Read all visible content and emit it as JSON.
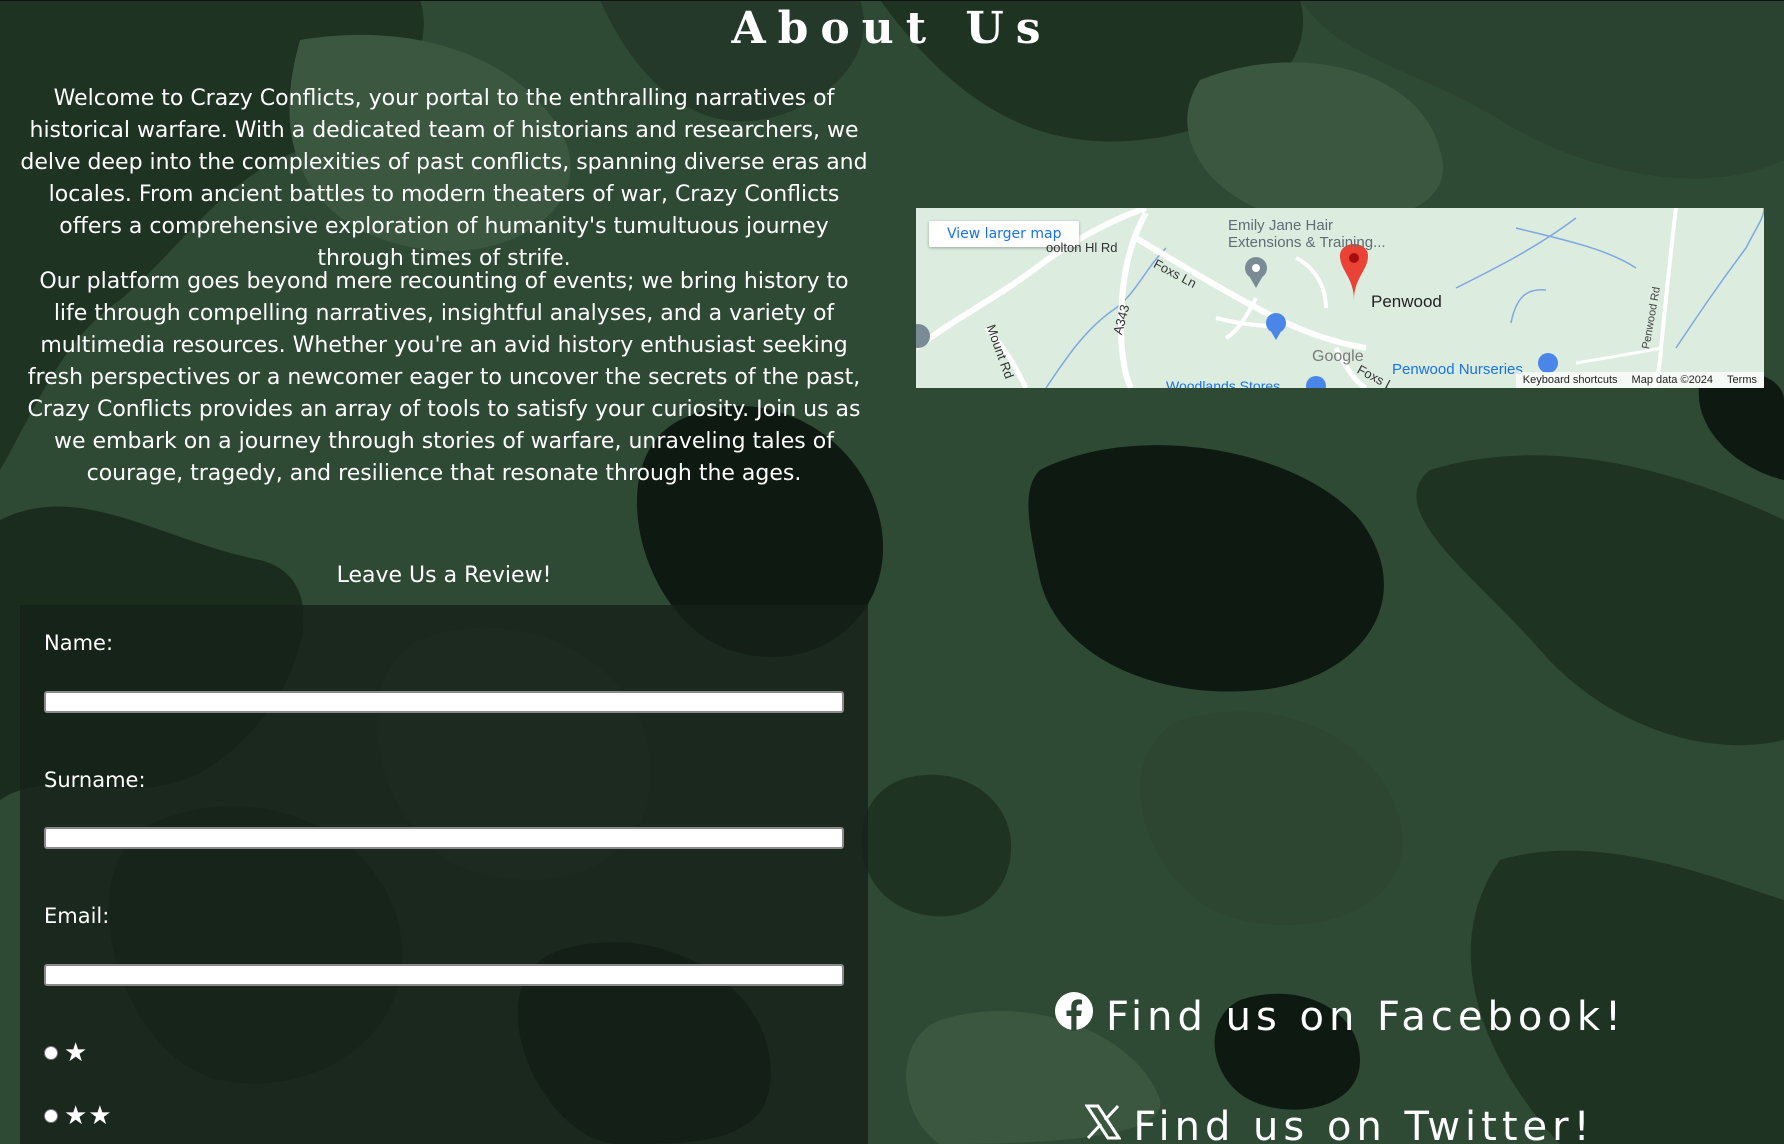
{
  "page": {
    "title": "About Us"
  },
  "about": {
    "paragraph1": "Welcome to Crazy Conflicts, your portal to the enthralling narratives of historical warfare. With a dedicated team of historians and researchers, we delve deep into the complexities of past conflicts, spanning diverse eras and locales. From ancient battles to modern theaters of war, Crazy Conflicts offers a comprehensive exploration of humanity's tumultuous journey through times of strife.",
    "paragraph2": "Our platform goes beyond mere recounting of events; we bring history to life through compelling narratives, insightful analyses, and a variety of multimedia resources. Whether you're an avid history enthusiast seeking fresh perspectives or a newcomer eager to uncover the secrets of the past, Crazy Conflicts provides an array of tools to satisfy your curiosity. Join us as we embark on a journey through stories of warfare, unraveling tales of courage, tragedy, and resilience that resonate through the ages."
  },
  "review": {
    "heading": "Leave Us a Review!",
    "name_label": "Name:",
    "name_value": "",
    "surname_label": "Surname:",
    "surname_value": "",
    "email_label": "Email:",
    "email_value": "",
    "ratings": [
      {
        "stars": "★"
      },
      {
        "stars": "★★"
      }
    ]
  },
  "map": {
    "button": "View larger map",
    "labels": {
      "business": "Emily Jane Hair",
      "business2": "Extensions & Training...",
      "road1": "oolton Hl Rd",
      "road2": "Foxs Ln",
      "road3": "A343",
      "road4": "Mount Rd",
      "road5": "Penwood Rd",
      "road6": "Foxs L",
      "place": "Penwood",
      "nursery": "Penwood Nurseries",
      "store": "Woodlands Stores",
      "google": "Google"
    },
    "footer": {
      "shortcuts": "Keyboard shortcuts",
      "mapdata": "Map data ©2024",
      "terms": "Terms"
    },
    "colors": {
      "land": "#dcecdf",
      "pin": "#ea4335",
      "water": "#7fa7e0",
      "link": "#1a73e8"
    }
  },
  "social": {
    "facebook": "Find us on Facebook!",
    "twitter": "Find us on Twitter!",
    "facebook_icon": "facebook-icon",
    "twitter_icon": "x-twitter-icon"
  },
  "theme": {
    "camo_light": "#3b5740",
    "camo_mid": "#2d4632",
    "camo_dark": "#1f3323",
    "camo_black": "#0e1a11"
  }
}
